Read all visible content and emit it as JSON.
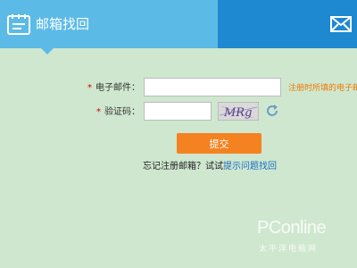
{
  "header": {
    "title": "邮箱找回",
    "icon": "notepad-icon",
    "right_icon": "envelope-icon",
    "colors": {
      "left": "#5bbbe6",
      "right": "#1e88d0"
    }
  },
  "form": {
    "email_label": "电子邮件：",
    "email_value": "",
    "email_hint": "注册时所填的电子邮",
    "captcha_label": "验证码：",
    "captcha_value": "",
    "captcha_text": "MRg",
    "required_mark": "*",
    "submit_label": "提交"
  },
  "footer": {
    "prefix": "忘记注册邮箱？试试",
    "link": "提示问题找回"
  },
  "watermark": {
    "brand": "PConline",
    "sub": "太平洋电脑网"
  },
  "colors": {
    "background": "#cfe7cf",
    "accent": "#f58220",
    "hint": "#f07800",
    "link": "#1a6fc0"
  }
}
